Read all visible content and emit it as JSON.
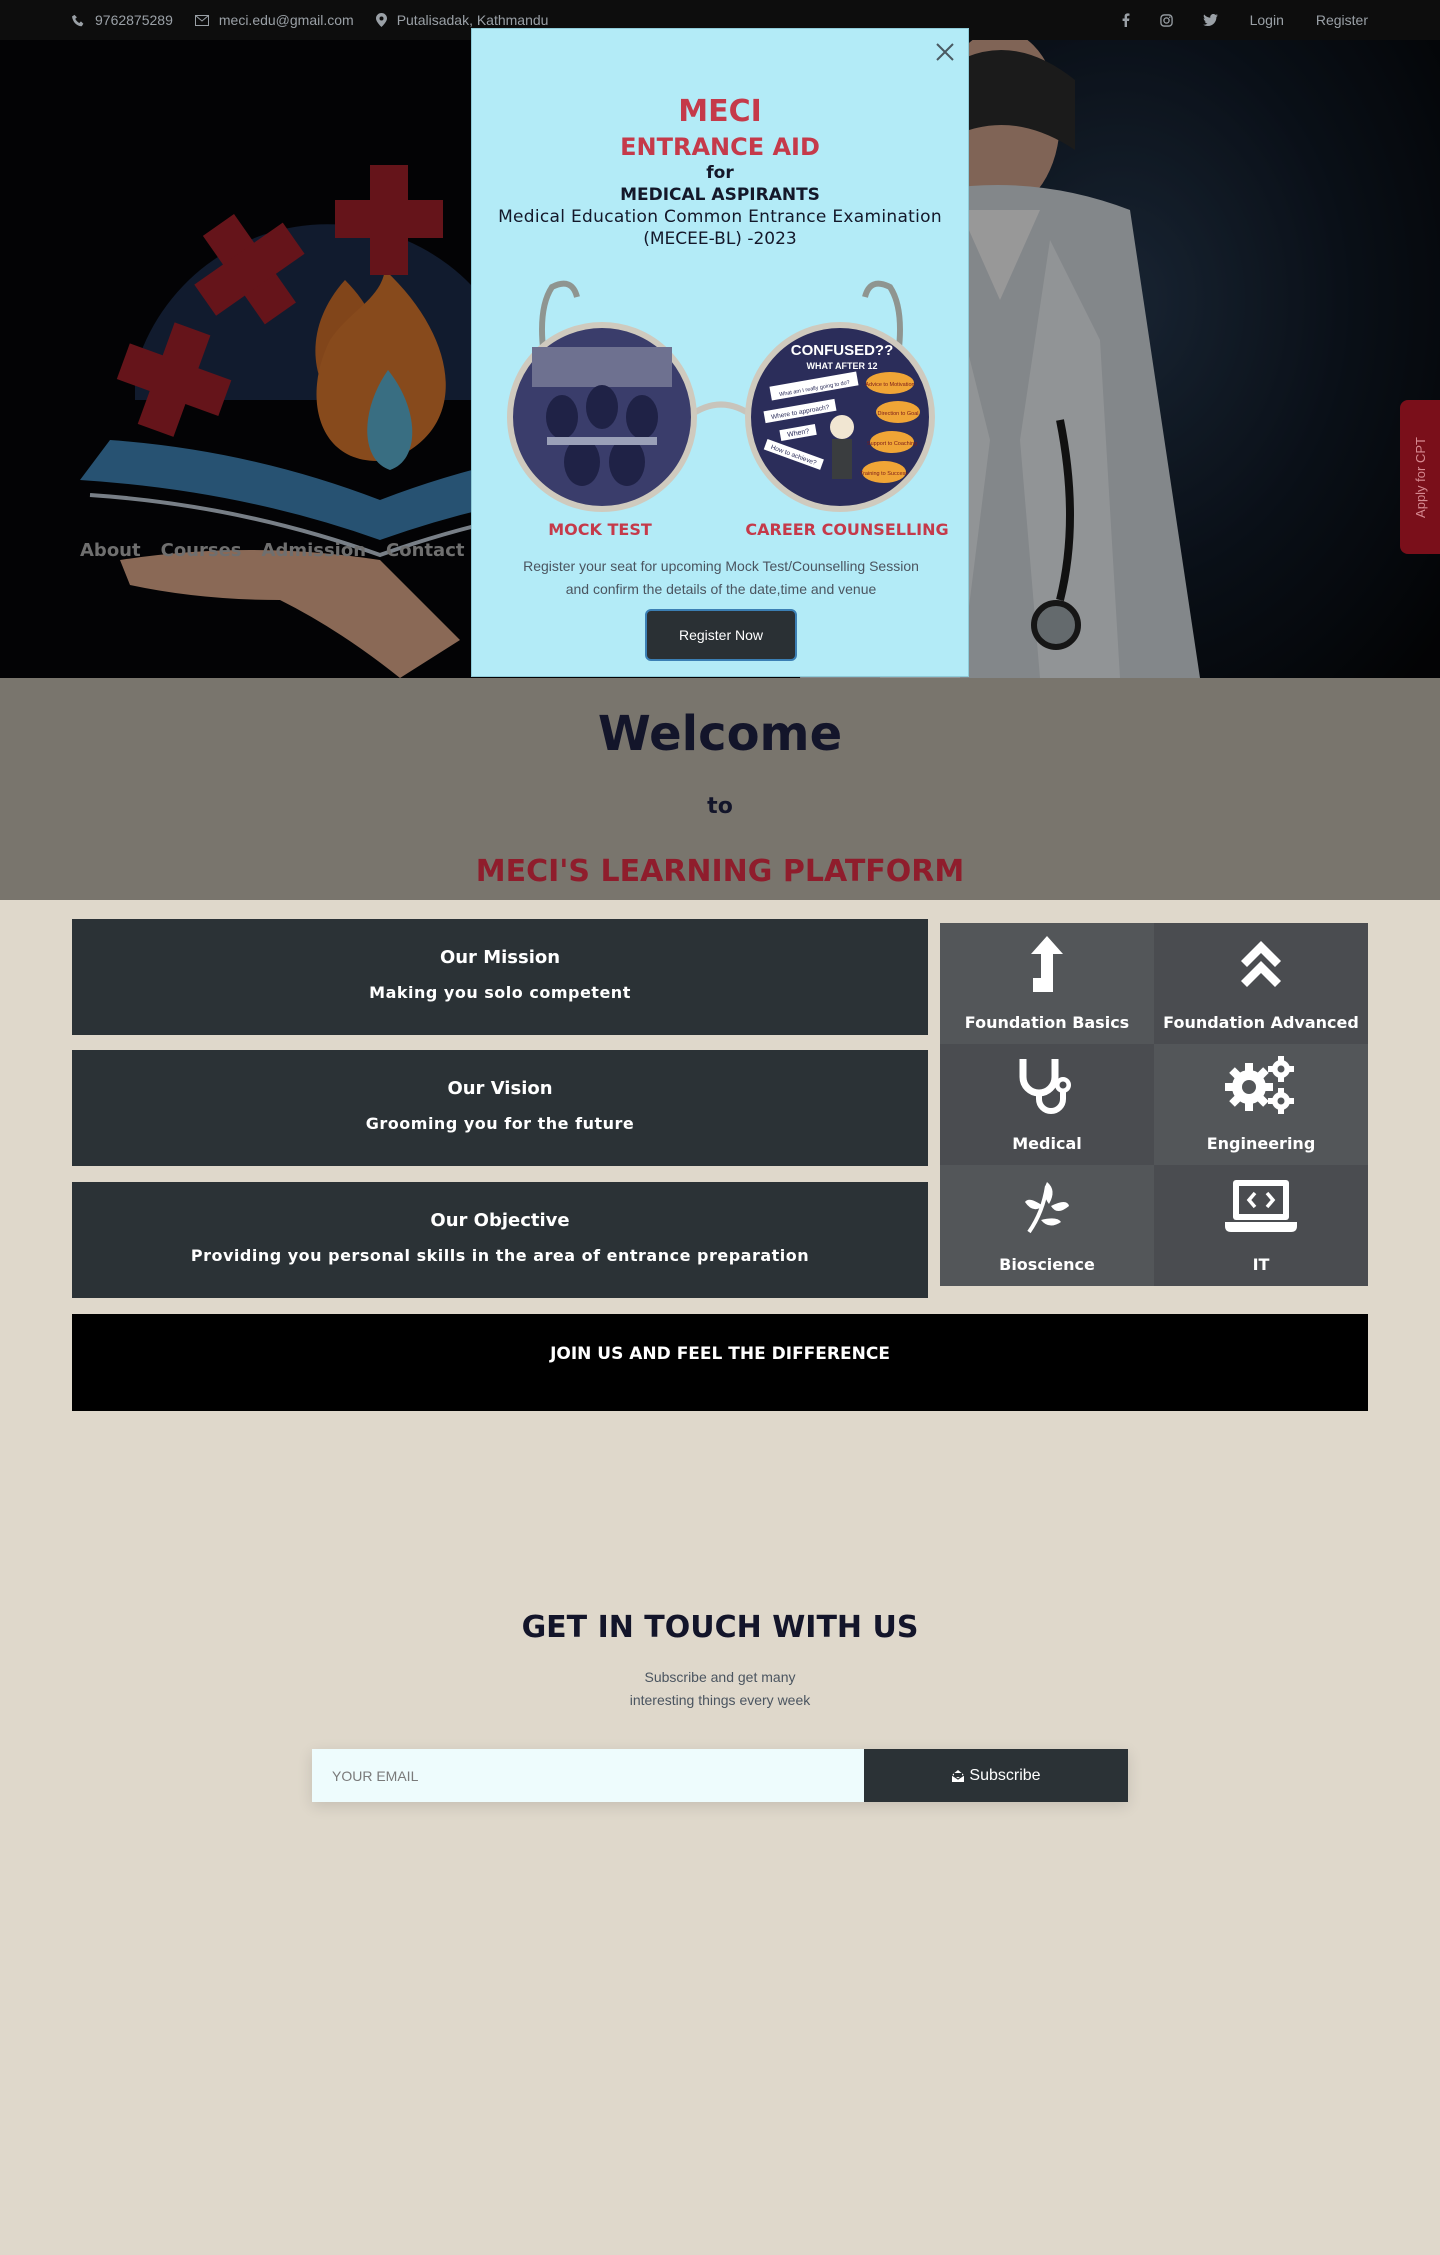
{
  "topbar": {
    "phone": "9762875289",
    "email": "meci.edu@gmail.com",
    "location": "Putalisadak, Kathmandu",
    "social_icons": [
      "facebook-icon",
      "instagram-icon",
      "twitter-icon"
    ],
    "login": "Login",
    "register": "Register"
  },
  "hero": {
    "nav": [
      "About",
      "Courses",
      "Admission",
      "Contact"
    ],
    "side_tab": "Apply for CPT"
  },
  "modal": {
    "title": "MECI",
    "subtitle": "ENTRANCE AID",
    "for": "for",
    "aspirants": "MEDICAL ASPIRANTS",
    "exam": "Medical Education Common Entrance Examination",
    "exam_code": "(MECEE-BL) -2023",
    "lens_right_texts": [
      "CONFUSED??",
      "WHAT AFTER 12",
      "What am I really going to do?",
      "Where to approach?",
      "When?",
      "How to achieve?",
      "Advice to Motivation",
      "Direction to Goal",
      "Support to Coaching",
      "Training to Success"
    ],
    "label_left": "MOCK TEST",
    "label_right": "CAREER COUNSELLING",
    "description_1": "Register your seat for upcoming Mock Test/Counselling Session",
    "description_2": "and confirm the details of the date,time and venue",
    "button": "Register Now"
  },
  "welcome": {
    "heading": "Welcome",
    "to": "to",
    "platform": "MECI'S LEARNING PLATFORM"
  },
  "info_boxes": [
    {
      "title": "Our Mission",
      "text": "Making you solo competent"
    },
    {
      "title": "Our Vision",
      "text": "Grooming you for the future"
    },
    {
      "title": "Our Objective",
      "text": "Providing you personal skills in the area of entrance preparation"
    }
  ],
  "courses": [
    {
      "label": "Foundation Basics",
      "icon": "arrow-up-icon"
    },
    {
      "label": "Foundation Advanced",
      "icon": "double-chevron-up-icon"
    },
    {
      "label": "Medical",
      "icon": "stethoscope-icon"
    },
    {
      "label": "Engineering",
      "icon": "gears-icon"
    },
    {
      "label": "Bioscience",
      "icon": "leaf-icon"
    },
    {
      "label": "IT",
      "icon": "laptop-code-icon"
    }
  ],
  "join": "JOIN US AND FEEL THE DIFFERENCE",
  "touch": {
    "title": "GET IN TOUCH WITH US",
    "sub_1": "Subscribe and get many",
    "sub_2": "interesting things every week",
    "placeholder": "YOUR EMAIL",
    "button": "Subscribe"
  },
  "colors": {
    "accent_red": "#c53a4a",
    "dark_red": "#8f1d2c",
    "navy": "#13152a",
    "panel_dark": "#2b3236",
    "modal_bg": "#b3ebf7",
    "page_bg": "#dfd8cb"
  }
}
